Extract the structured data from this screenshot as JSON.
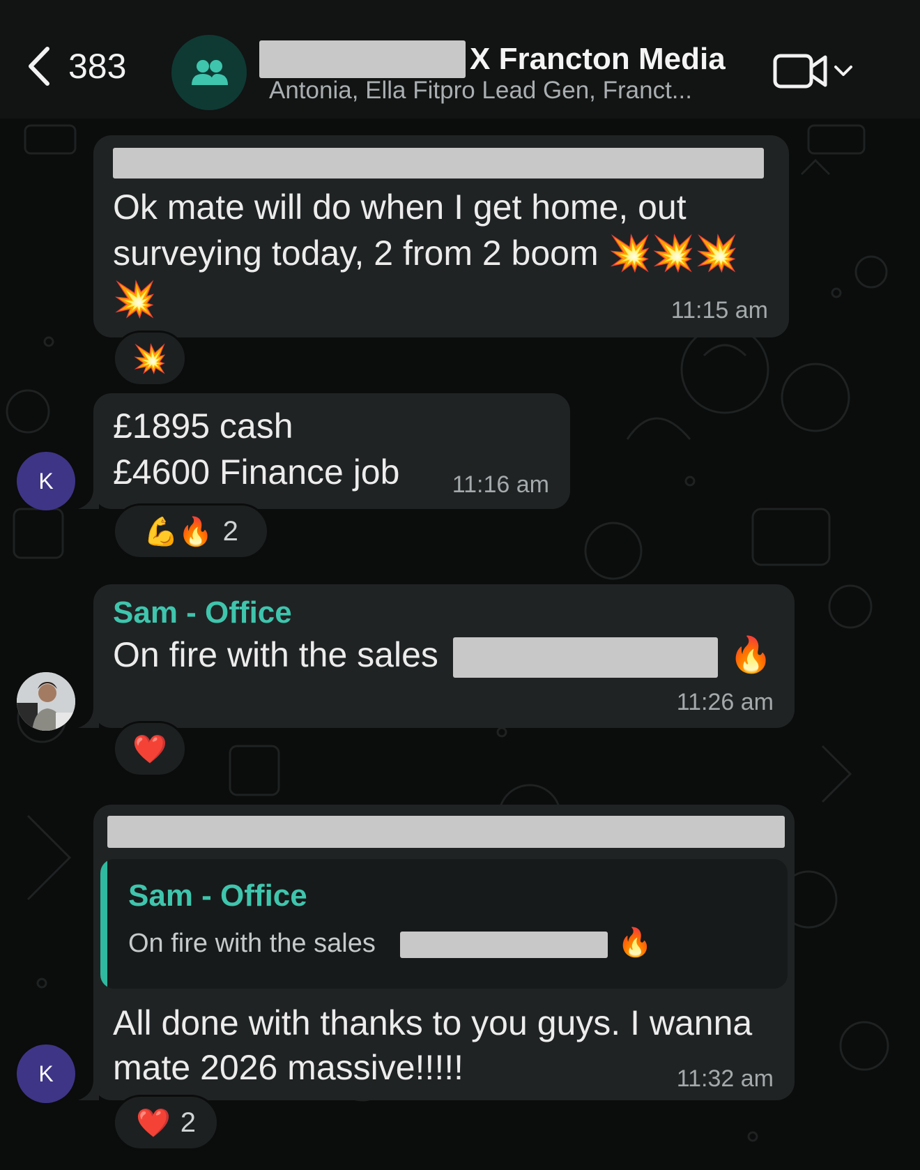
{
  "header": {
    "back_count": "383",
    "title": "X Francton Media",
    "subtitle": "Antonia, Ella Fitpro Lead Gen, Franct..."
  },
  "icons": {
    "back": "chevron-left-icon",
    "group": "group-icon",
    "video": "video-camera-icon",
    "dropdown": "chevron-down-icon"
  },
  "messages": [
    {
      "text_lines": [
        "Ok mate will do when I get home, out",
        "surveying today, 2 from 2 boom 💥💥💥",
        "💥"
      ],
      "time": "11:15 am",
      "reactions": {
        "emoji": "💥",
        "count": ""
      }
    },
    {
      "avatar": "K",
      "text_lines": [
        "£1895 cash",
        "£4600 Finance job"
      ],
      "time": "11:16 am",
      "reactions": {
        "emoji": "💪🔥",
        "count": "2"
      }
    },
    {
      "sender": "Sam - Office",
      "text_lines": [
        "On fire with the sales"
      ],
      "trailing_emoji": "🔥",
      "time": "11:26 am",
      "reactions": {
        "emoji": "❤️",
        "count": ""
      }
    },
    {
      "avatar": "K",
      "quote": {
        "sender": "Sam - Office",
        "text": "On fire with the sales",
        "emoji": "🔥"
      },
      "text_lines": [
        "All done with thanks to you guys. I wanna",
        "mate 2026 massive!!!!!"
      ],
      "time": "11:32 am",
      "reactions": {
        "emoji": "❤️",
        "count": "2"
      }
    }
  ],
  "colors": {
    "background": "#0b0c0c",
    "bubble": "#202324",
    "accent": "#3fc5ad",
    "avatar_k": "#3e3587"
  }
}
